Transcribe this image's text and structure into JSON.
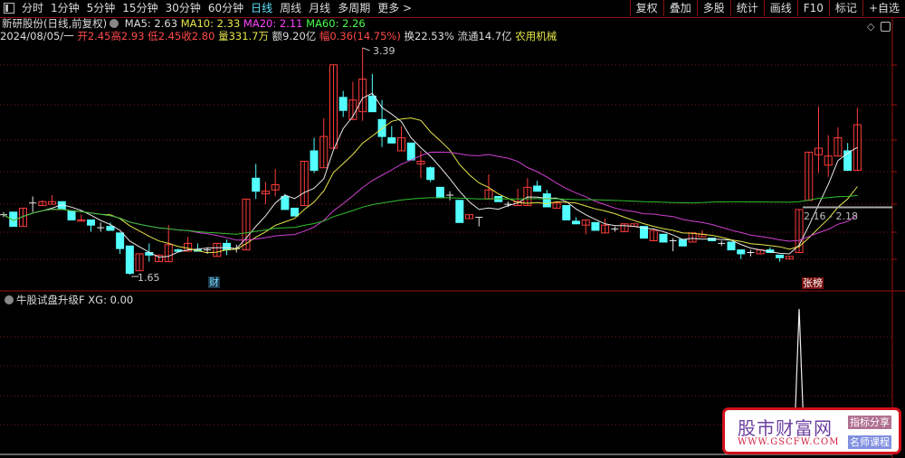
{
  "toolbar": {
    "periods": [
      "分时",
      "1分钟",
      "5分钟",
      "15分钟",
      "30分钟",
      "60分钟",
      "日线",
      "周线",
      "月线",
      "多周期",
      "更多 >"
    ],
    "active_period": "日线",
    "tools": [
      "复权",
      "叠加",
      "多股",
      "统计",
      "画线",
      "F10",
      "标记",
      "+自选"
    ]
  },
  "header": {
    "stock_name": "新研股份(日线,前复权)",
    "ma5": "MA5: 2.63",
    "ma10": "MA10: 2.33",
    "ma20": "MA20: 2.11",
    "ma60": "MA60: 2.26",
    "date": "2024/08/05/一",
    "open": "开2.45",
    "high": "高2.93",
    "low": "低2.45",
    "close": "收2.80",
    "volume": "量331.7万",
    "amount": "额9.20亿",
    "change": "幅0.36(14.75%)",
    "turnover": "换22.53%",
    "float_cap": "流通14.7亿",
    "sector": "农用机械"
  },
  "annotations": {
    "high_label": "3.39",
    "low_label": "1.65",
    "range_label": "2.16 - 2.18",
    "tag_cai": "财",
    "tag_zhangbang": "张榜"
  },
  "indicator": {
    "title": "牛股试盘升级F",
    "value": "XG: 0.00"
  },
  "watermark": {
    "name": "股市财富网",
    "url": "WWW.GSCFW.COM",
    "badge1": "指标分享",
    "badge2": "名师课程"
  },
  "colors": {
    "up": "#ff3c3c",
    "down": "#54ffff",
    "ma5": "#e8e8e8",
    "ma10": "#e6e64a",
    "ma20": "#d040d0",
    "ma60": "#30c030",
    "grid": "#7a1a1a"
  },
  "chart_data": {
    "type": "candlestick",
    "ylim": [
      1.6,
      3.42
    ],
    "candles_ohlc": [
      [
        2.11,
        2.13,
        2.09,
        2.11
      ],
      [
        2.13,
        2.13,
        2.02,
        2.02
      ],
      [
        2.02,
        2.16,
        2.02,
        2.16
      ],
      [
        2.2,
        2.25,
        2.13,
        2.2
      ],
      [
        2.18,
        2.22,
        2.18,
        2.21
      ],
      [
        2.19,
        2.26,
        2.19,
        2.21
      ],
      [
        2.21,
        2.21,
        2.15,
        2.15
      ],
      [
        2.14,
        2.14,
        2.07,
        2.07
      ],
      [
        2.06,
        2.11,
        2.06,
        2.07
      ],
      [
        2.07,
        2.07,
        1.98,
        2.03
      ],
      [
        2.01,
        2.05,
        1.98,
        2.01
      ],
      [
        2.02,
        2.05,
        1.99,
        1.99
      ],
      [
        1.97,
        1.97,
        1.81,
        1.85
      ],
      [
        1.87,
        1.87,
        1.65,
        1.66
      ],
      [
        1.68,
        1.81,
        1.68,
        1.81
      ],
      [
        1.82,
        1.89,
        1.75,
        1.8
      ],
      [
        1.75,
        1.8,
        1.75,
        1.8
      ],
      [
        1.75,
        2.03,
        1.75,
        1.88
      ],
      [
        1.84,
        1.85,
        1.83,
        1.83
      ],
      [
        1.83,
        1.94,
        1.83,
        1.89
      ],
      [
        1.84,
        1.89,
        1.83,
        1.83
      ],
      [
        1.84,
        1.86,
        1.81,
        1.84
      ],
      [
        1.79,
        1.89,
        1.79,
        1.89
      ],
      [
        1.89,
        1.92,
        1.8,
        1.84
      ],
      [
        1.85,
        1.88,
        1.82,
        1.85
      ],
      [
        1.84,
        2.23,
        1.84,
        2.23
      ],
      [
        2.39,
        2.5,
        2.23,
        2.29
      ],
      [
        2.27,
        2.36,
        2.19,
        2.29
      ],
      [
        2.3,
        2.46,
        2.25,
        2.34
      ],
      [
        2.25,
        2.27,
        2.15,
        2.15
      ],
      [
        2.16,
        2.16,
        2.1,
        2.1
      ],
      [
        2.18,
        2.52,
        2.18,
        2.52
      ],
      [
        2.6,
        2.7,
        2.43,
        2.45
      ],
      [
        2.47,
        2.85,
        2.47,
        2.71
      ],
      [
        2.62,
        3.26,
        2.62,
        3.26
      ],
      [
        3.01,
        3.06,
        2.86,
        2.91
      ],
      [
        2.84,
        3.13,
        2.84,
        2.99
      ],
      [
        2.9,
        3.39,
        2.83,
        3.15
      ],
      [
        3.02,
        3.19,
        2.9,
        2.9
      ],
      [
        2.84,
        2.99,
        2.63,
        2.71
      ],
      [
        2.7,
        2.79,
        2.66,
        2.66
      ],
      [
        2.6,
        2.79,
        2.6,
        2.7
      ],
      [
        2.66,
        2.66,
        2.53,
        2.53
      ],
      [
        2.5,
        2.6,
        2.39,
        2.52
      ],
      [
        2.47,
        2.48,
        2.36,
        2.38
      ],
      [
        2.32,
        2.32,
        2.24,
        2.24
      ],
      [
        2.26,
        2.29,
        2.22,
        2.26
      ],
      [
        2.22,
        2.22,
        2.05,
        2.05
      ],
      [
        2.08,
        2.11,
        2.08,
        2.11
      ],
      [
        2.09,
        2.09,
        2.02,
        2.09
      ],
      [
        2.23,
        2.42,
        2.23,
        2.3
      ],
      [
        2.25,
        2.25,
        2.21,
        2.21
      ],
      [
        2.19,
        2.21,
        2.17,
        2.19
      ],
      [
        2.18,
        2.31,
        2.18,
        2.21
      ],
      [
        2.18,
        2.39,
        2.18,
        2.32
      ],
      [
        2.33,
        2.37,
        2.29,
        2.29
      ],
      [
        2.27,
        2.3,
        2.17,
        2.17
      ],
      [
        2.16,
        2.2,
        2.16,
        2.2
      ],
      [
        2.18,
        2.18,
        2.07,
        2.07
      ],
      [
        2.06,
        2.09,
        2.04,
        2.04
      ],
      [
        2.03,
        2.07,
        1.96,
        2.07
      ],
      [
        2.05,
        2.05,
        1.99,
        1.99
      ],
      [
        1.97,
        2.08,
        1.97,
        2.03
      ],
      [
        2.0,
        2.02,
        1.98,
        2.0
      ],
      [
        1.98,
        2.04,
        1.98,
        2.04
      ],
      [
        2.02,
        2.04,
        2.02,
        2.04
      ],
      [
        2.02,
        2.02,
        1.93,
        1.93
      ],
      [
        1.91,
        1.99,
        1.91,
        1.99
      ],
      [
        1.96,
        1.96,
        1.9,
        1.9
      ],
      [
        1.91,
        1.93,
        1.83,
        1.91
      ],
      [
        1.92,
        1.92,
        1.87,
        1.87
      ],
      [
        1.9,
        1.97,
        1.9,
        1.97
      ],
      [
        1.94,
        1.99,
        1.94,
        1.96
      ],
      [
        1.93,
        1.93,
        1.91,
        1.91
      ],
      [
        1.89,
        1.91,
        1.87,
        1.89
      ],
      [
        1.9,
        1.9,
        1.84,
        1.84
      ],
      [
        1.84,
        1.84,
        1.77,
        1.81
      ],
      [
        1.82,
        1.84,
        1.79,
        1.82
      ],
      [
        1.81,
        1.84,
        1.81,
        1.84
      ],
      [
        1.84,
        1.86,
        1.82,
        1.82
      ],
      [
        1.8,
        1.8,
        1.75,
        1.78
      ],
      [
        1.77,
        1.79,
        1.77,
        1.79
      ],
      [
        1.82,
        2.15,
        1.82,
        2.15
      ],
      [
        2.22,
        2.59,
        2.22,
        2.59
      ],
      [
        2.57,
        2.94,
        2.43,
        2.62
      ],
      [
        2.49,
        2.72,
        2.4,
        2.56
      ],
      [
        2.56,
        2.78,
        2.56,
        2.7
      ],
      [
        2.6,
        2.66,
        2.45,
        2.45
      ],
      [
        2.45,
        2.93,
        2.45,
        2.8
      ]
    ],
    "moving_averages": [
      5,
      10,
      20,
      60
    ],
    "price_marker_range": [
      2.16,
      2.18
    ],
    "xg_signal_index": 82,
    "xg_range": [
      0,
      1
    ]
  }
}
